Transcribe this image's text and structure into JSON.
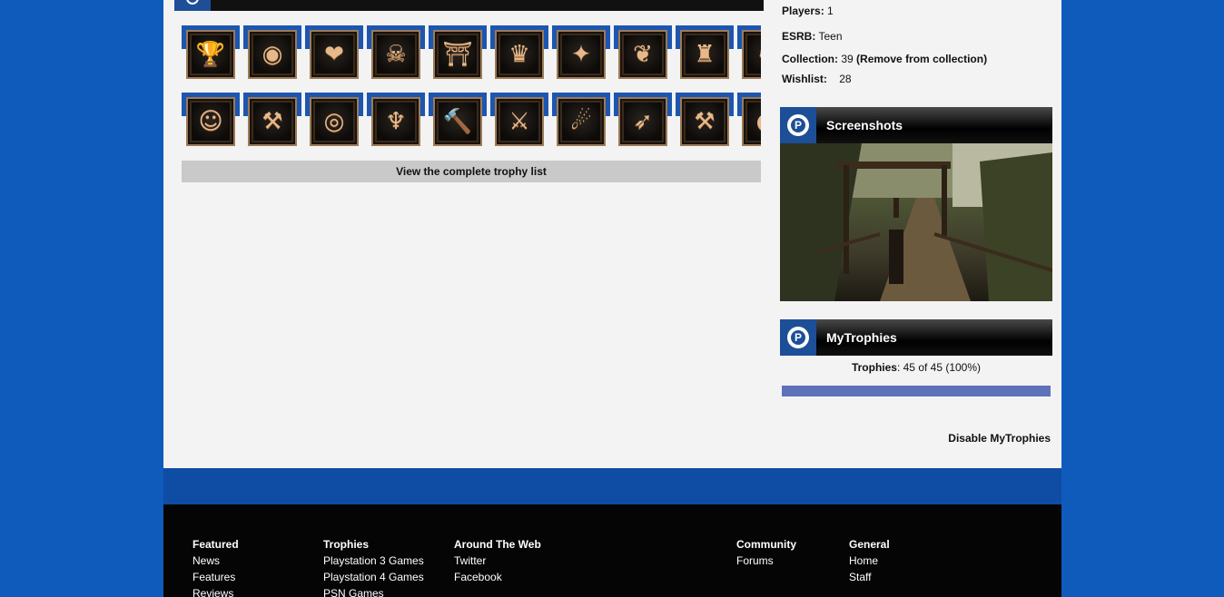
{
  "trophies": {
    "row1": [
      "🏆",
      "◉",
      "❤",
      "☠",
      "⛩",
      "♛",
      "✦",
      "❦",
      "♜",
      "♞"
    ],
    "row2": [
      "☺",
      "⚒",
      "◎",
      "♆",
      "🔨",
      "⚔",
      "☄",
      "➶",
      "⚒",
      "●"
    ],
    "view_all_label": "View the complete trophy list"
  },
  "game_info": {
    "players_label": "Players:",
    "players_value": "1",
    "esrb_label": "ESRB:",
    "esrb_value": "Teen",
    "collection_label": "Collection:",
    "collection_value": "39",
    "collection_action": "(Remove from collection)",
    "wishlist_label": "Wishlist:",
    "wishlist_value": "28"
  },
  "screenshots_panel": {
    "title": "Screenshots",
    "logo_letter": "P"
  },
  "mytrophies_panel": {
    "title": "MyTrophies",
    "logo_letter": "P",
    "trophies_label": "Trophies",
    "trophies_value": ": 45 of 45 (100%)",
    "progress_fraction": 1.0,
    "disable_label": "Disable MyTrophies"
  },
  "footer": {
    "featured": {
      "heading": "Featured",
      "links": [
        "News",
        "Features",
        "Reviews"
      ]
    },
    "trophies": {
      "heading": "Trophies",
      "links": [
        "Playstation 3 Games",
        "Playstation 4 Games",
        "PSN Games"
      ]
    },
    "around": {
      "heading": "Around The Web",
      "links": [
        "Twitter",
        "Facebook"
      ]
    },
    "community": {
      "heading": "Community",
      "links": [
        "Forums"
      ]
    },
    "general": {
      "heading": "General",
      "links": [
        "Home",
        "Staff"
      ]
    }
  },
  "colors": {
    "page_bg": "#0f5bbb",
    "panel_blue": "#1d4f98",
    "progress_fill": "#5d72bb"
  }
}
